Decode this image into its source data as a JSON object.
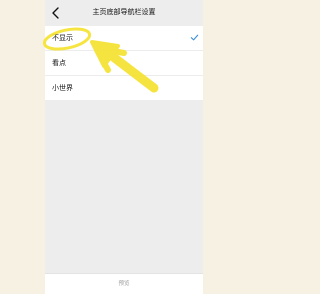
{
  "header": {
    "title": "主页底部导航栏设置"
  },
  "options": [
    {
      "label": "不显示",
      "selected": true
    },
    {
      "label": "看点",
      "selected": false
    },
    {
      "label": "小世界",
      "selected": false
    }
  ],
  "footer": {
    "button_label": "预览"
  },
  "colors": {
    "accent": "#07c160",
    "check": "#3d8ed8",
    "highlight": "#f5e22c"
  }
}
